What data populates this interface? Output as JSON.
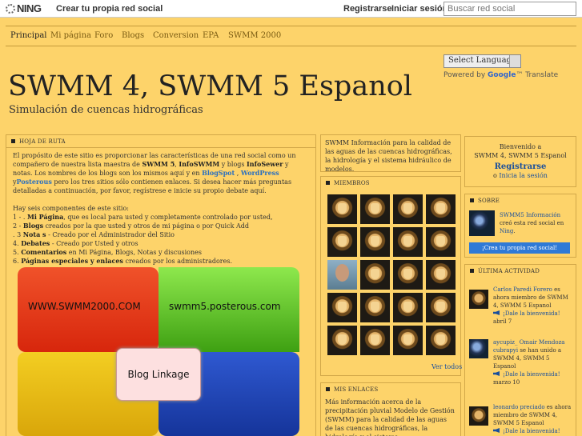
{
  "ningbar": {
    "logo": "NING",
    "create_network": "Crear tu propia red social",
    "register": "Registrarse",
    "login": "Iniciar sesión",
    "search_placeholder": "Buscar red social"
  },
  "nav": {
    "items": [
      "Principal",
      "Mi página",
      "Foro",
      "Blogs",
      "Conversion",
      "EPA",
      "SWMM 2000"
    ]
  },
  "header": {
    "title": "SWMM 4, SWMM 5 Espanol",
    "subtitle": "Simulación de cuencas hidrográficas",
    "language_select": "Select Language",
    "powered_prefix": "Powered by",
    "powered_brand": "Google",
    "powered_suffix": "™ Translate"
  },
  "roadmap": {
    "heading": "HOJA DE RUTA",
    "p1_a": "El propósito de este sitio es proporcionar las características de una red social como un compañero de nuestra lista maestra de ",
    "p1_b": "SWMM 5",
    "p1_c": ", ",
    "p1_d": "InfoSWMM",
    "p1_e": " y blogs ",
    "p1_f": "InfoSewer",
    "p1_g": " y notas. Los nombres de los blogs son los mismos aquí y en ",
    "p1_h": "BlogSpot",
    "p1_i": " , ",
    "p1_j": "WordPress",
    "p1_k": " y",
    "p1_l": "Posterous",
    "p1_m": " pero los tres sitios sólo contienen enlaces. Si desea hacer más preguntas detalladas a continuación, por favor, regístrese e inicie su propio debate aquí.",
    "p2": "Hay seis componentes de este sitio:",
    "l1_a": "1 - . ",
    "l1_b": "Mi Página",
    "l1_c": ", que es local para usted y completamente controlado por usted,",
    "l2_a": "2 - ",
    "l2_b": "Blogs",
    "l2_c": " creados por la que usted y otros de mi página o por Quick Add",
    "l3_a": ". 3 ",
    "l3_b": "Nota s",
    "l3_c": " - Creado por el Administrador del Sitio",
    "l4_a": "4. ",
    "l4_b": "Debates",
    "l4_c": " - Creado por Usted y otros",
    "l5_a": "5. ",
    "l5_b": "Comentarios",
    "l5_c": " en Mi Página, Blogs, Notas y discusiones",
    "l6_a": "6. ",
    "l6_b": "Páginas especiales y enlaces",
    "l6_c": " creados por los administradores.",
    "graphic": {
      "top_left": "WWW.SWMM2000.COM",
      "top_right": "swmm5.posterous.com",
      "center": "Blog Linkage"
    }
  },
  "info_box": {
    "text": "SWMM Información para la calidad de las aguas de las cuencas hidrográficas, la hidrología y el sistema hidráulico de modelos."
  },
  "members": {
    "heading": "MIEMBROS",
    "see_all": "Ver todos"
  },
  "links": {
    "heading": "MIS ENLACES",
    "text": "Más información acerca de la precipitación pluvial Modelo de Gestión (SWMM) para la calidad de las aguas de las cuencas hidrográficas, la hidrología y el sistema"
  },
  "welcome": {
    "line1": "Bienvenido a",
    "line2": "SWMM 4, SWMM 5 Espanol",
    "register": "Registrarse",
    "or": "o",
    "login": "Inicia la sesión"
  },
  "about": {
    "heading": "SOBRE",
    "owner": "SWMM5 Información",
    "text": " creó esta red social en ",
    "ning": "Ning",
    "create_btn": "¡Crea tu propia red social!"
  },
  "activity": {
    "heading": "ÚLTIMA ACTIVIDAD",
    "items": [
      {
        "name": "Carlos Paredi Forero",
        "action": " es ahora miembro de SWMM 4, SWMM 5 Espanol",
        "welcome": "¡Dale la bienvenida!",
        "date": "abril 7"
      },
      {
        "name": "aycupiz_ Omair Mendoza cubrapyi",
        "action": " se han unido a SWMM 4, SWMM 5 Espanol",
        "welcome": "¡Dale la bienvenida!",
        "date": "marzo 10"
      },
      {
        "name": "leonardo preciado",
        "action": " es ahora miembro de SWMM 4, SWMM 5 Espanol",
        "welcome": "¡Dale la bienvenida!",
        "date": ""
      }
    ]
  }
}
